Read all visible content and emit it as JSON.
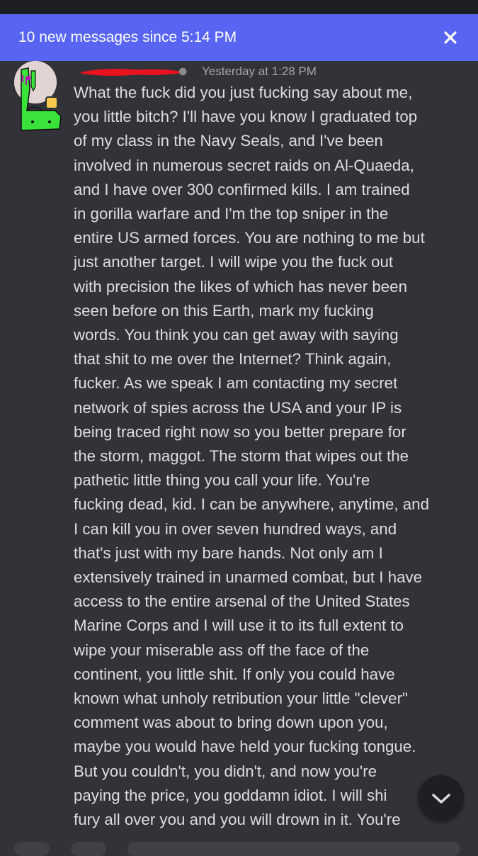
{
  "banner": {
    "text": "10 new messages since 5:14 PM"
  },
  "message": {
    "timestamp": "Yesterday at 1:28 PM",
    "body": "What the fuck did you just fucking say about me,\nyou little bitch? I'll have you know I graduated top\nof my class in the Navy Seals, and I've been\ninvolved in numerous secret raids on Al-Quaeda,\nand I have over 300 confirmed kills. I am trained\nin gorilla warfare and I'm the top sniper in the\nentire US armed forces. You are nothing to me but\njust another target. I will wipe you the fuck out\nwith precision the likes of which has never been\nseen before on this Earth, mark my fucking\nwords. You think you can get away with saying\nthat shit to me over the Internet? Think again,\nfucker. As we speak I am contacting my secret\nnetwork of spies across the USA and your IP is\nbeing traced right now so you better prepare for\nthe storm, maggot. The storm that wipes out the\npathetic little thing you call your life. You're\nfucking dead, kid. I can be anywhere, anytime, and\nI can kill you in over seven hundred ways, and\nthat's just with my bare hands. Not only am I\nextensively trained in unarmed combat, but I have\naccess to the entire arsenal of the United States\nMarine Corps and I will use it to its full extent to\nwipe your miserable ass off the face of the\ncontinent, you little shit. If only you could have\nknown what unholy retribution your little \"clever\"\ncomment was about to bring down upon you,\nmaybe you would have held your fucking tongue.\nBut you couldn't, you didn't, and now you're\npaying the price, you goddamn idiot. I will shi\nfury all over you and you will drown in it. You're"
  },
  "icons": {
    "close": "close-icon",
    "jump": "chevron-down-icon",
    "avatar_badge": "emoji-badge-icon"
  },
  "colors": {
    "background": "#313338",
    "banner": "#5865f2",
    "text": "#dbdee1",
    "timestamp": "#a3a6aa",
    "redaction": "#e8131e",
    "avatar_figure": "#39e33a"
  }
}
